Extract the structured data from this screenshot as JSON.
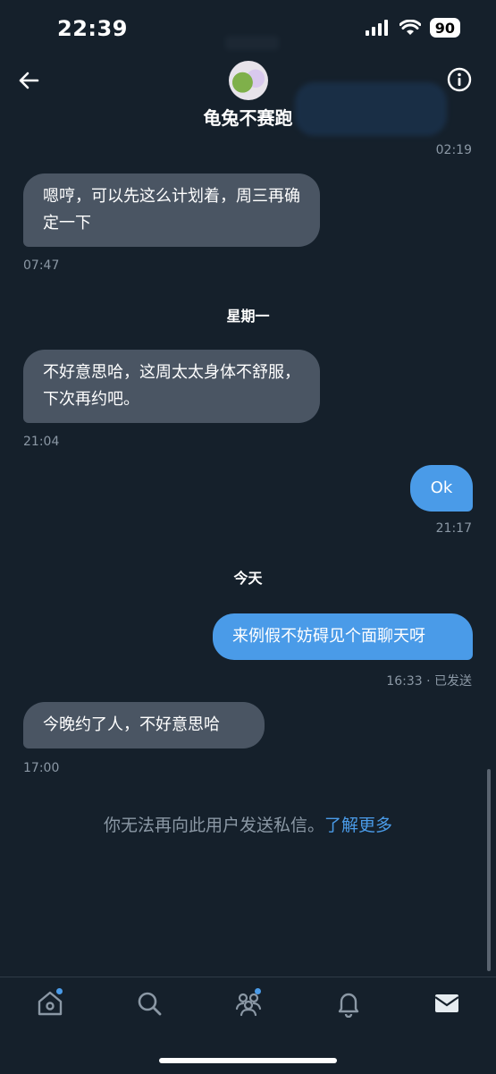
{
  "status_bar": {
    "time": "22:39",
    "battery": "90"
  },
  "header": {
    "title": "龟兔不赛跑"
  },
  "messages": [
    {
      "text": "02:19"
    },
    {
      "text": "嗯哼，可以先这么计划着，周三再确定一下",
      "time": "07:47"
    },
    {
      "day": "星期一"
    },
    {
      "text": "不好意思哈，这周太太身体不舒服，下次再约吧。",
      "time": "21:04"
    },
    {
      "text": "Ok",
      "time": "21:17"
    },
    {
      "day": "今天"
    },
    {
      "text": "来例假不妨碍见个面聊天呀",
      "time": "16:33 · 已发送"
    },
    {
      "text": "今晚约了人，不好意思哈",
      "time": "17:00"
    }
  ],
  "notice": {
    "text": "你无法再向此用户发送私信。",
    "link": "了解更多"
  },
  "nav": [
    "home-icon",
    "search-icon",
    "communities-icon",
    "notifications-icon",
    "messages-icon"
  ],
  "colors": {
    "background": "#15202b",
    "incoming": "#4a5563",
    "outgoing": "#4a9be8",
    "accent": "#4a9be8"
  }
}
